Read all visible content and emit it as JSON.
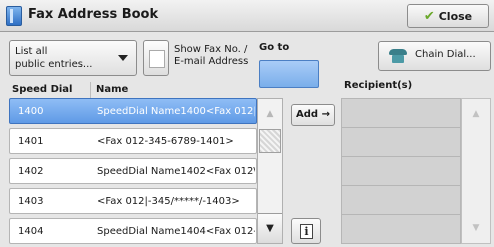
{
  "window": {
    "title": "Fax Address Book",
    "close_label": "Close"
  },
  "filter": {
    "list_option": "List all\npublic entries...",
    "show_label": "Show Fax No. /\nE-mail Address"
  },
  "goto": {
    "label": "Go to",
    "value": ""
  },
  "chain_dial": {
    "label": "Chain Dial..."
  },
  "columns": {
    "speed_dial": "Speed Dial",
    "name": "Name"
  },
  "entries": [
    {
      "speed_dial": "1400",
      "name": "SpeedDial Name1400<Fax 012|-",
      "selected": true
    },
    {
      "speed_dial": "1401",
      "name": "<Fax 012-345-6789-1401>",
      "selected": false
    },
    {
      "speed_dial": "1402",
      "name": "SpeedDial Name1402<Fax 012\\",
      "selected": false
    },
    {
      "speed_dial": "1403",
      "name": "<Fax 012|-345/*****/-1403>",
      "selected": false
    },
    {
      "speed_dial": "1404",
      "name": "SpeedDial Name1404<Fax 012-",
      "selected": false
    }
  ],
  "actions": {
    "add_label": "Add →"
  },
  "recipients": {
    "label": "Recipient(s)",
    "items": []
  },
  "colors": {
    "selected_row": "#5f9ae6",
    "goto_field": "#7aaeea",
    "close_check": "#6aa82a"
  },
  "icons": {
    "title": "address-book-icon",
    "close": "checkmark-icon",
    "chain": "phone-icon",
    "info": "info-icon"
  }
}
